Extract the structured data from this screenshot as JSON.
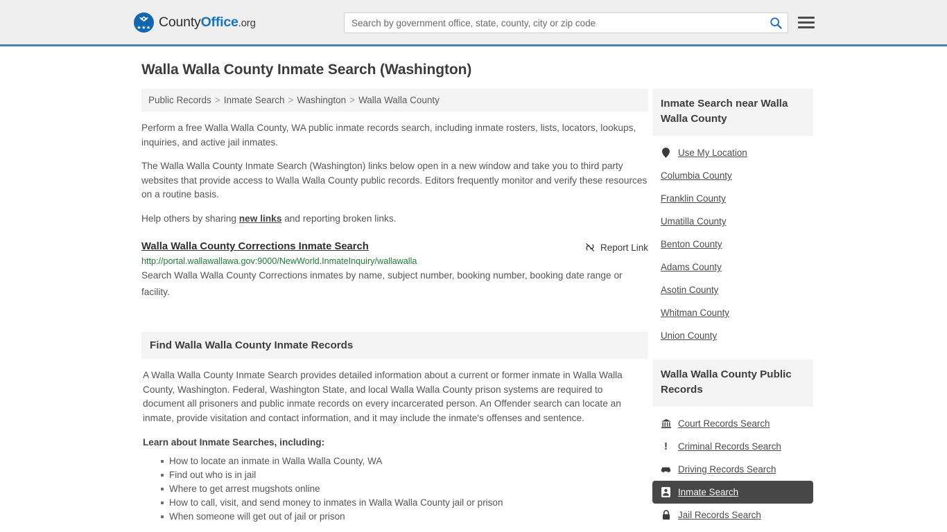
{
  "header": {
    "logo": {
      "part1": "County",
      "part2": "Office",
      "part3": ".org",
      "icon": "eagle-seal-logo"
    },
    "search": {
      "placeholder": "Search by government office, state, county, city or zip code",
      "value": "",
      "search_icon": "search-icon",
      "accent_color": "#1a6bb5"
    },
    "menu_icon": "hamburger-menu-icon",
    "border_color": "#4a7fad"
  },
  "main": {
    "title": "Walla Walla County Inmate Search (Washington)",
    "breadcrumb": [
      "Public Records",
      "Inmate Search",
      "Washington",
      "Walla Walla County"
    ],
    "breadcrumb_separator": ">",
    "paragraphs": [
      "Perform a free Walla Walla County, WA public inmate records search, including inmate rosters, lists, locators, lookups, inquiries, and active jail inmates.",
      "The Walla Walla County Inmate Search (Washington) links below open in a new window and take you to third party websites that provide access to Walla Walla County public records. Editors frequently monitor and verify these resources on a routine basis."
    ],
    "share_prefix": "Help others by sharing ",
    "share_link": "new links",
    "share_suffix": " and reporting broken links.",
    "resource": {
      "title": "Walla Walla County Corrections Inmate Search",
      "report_label": "Report Link",
      "report_icon": "broken-link-icon",
      "url": "http://portal.wallawallawa.gov:9000/NewWorld.InmateInquiry/wallawalla",
      "url_color": "#207b36",
      "description": "Search Walla Walla County Corrections inmates by name, subject number, booking number, booking date range or facility."
    },
    "section": {
      "heading": "Find Walla Walla County Inmate Records",
      "body": "A Walla Walla County Inmate Search provides detailed information about a current or former inmate in Walla Walla County, Washington. Federal, Washington State, and local Walla Walla County prison systems are required to document all prisoners and public inmate records on every incarcerated person. An Offender search can locate an inmate, provide visitation and contact information, and it may include the inmate's offenses and sentence.",
      "lead_in": "Learn about Inmate Searches, including:",
      "bullets": [
        "How to locate an inmate in Walla Walla County, WA",
        "Find out who is in jail",
        "Where to get arrest mugshots online",
        "How to call, visit, and send money to inmates in Walla Walla County jail or prison",
        "When someone will get out of jail or prison"
      ]
    }
  },
  "sidebar": {
    "nearby": {
      "heading": "Inmate Search near Walla Walla County",
      "items": [
        {
          "label": "Use My Location",
          "icon": "map-pin-icon"
        },
        {
          "label": "Columbia County",
          "icon": ""
        },
        {
          "label": "Franklin County",
          "icon": ""
        },
        {
          "label": "Umatilla County",
          "icon": ""
        },
        {
          "label": "Benton County",
          "icon": ""
        },
        {
          "label": "Adams County",
          "icon": ""
        },
        {
          "label": "Asotin County",
          "icon": ""
        },
        {
          "label": "Whitman County",
          "icon": ""
        },
        {
          "label": "Union County",
          "icon": ""
        }
      ]
    },
    "records": {
      "heading": "Walla Walla County Public Records",
      "active_label": "Inmate Search",
      "active_bg": "#474747",
      "items": [
        {
          "label": "Court Records Search",
          "icon": "courthouse-icon",
          "active": false
        },
        {
          "label": "Criminal Records Search",
          "icon": "exclamation-icon",
          "active": false
        },
        {
          "label": "Driving Records Search",
          "icon": "car-icon",
          "active": false
        },
        {
          "label": "Inmate Search",
          "icon": "id-badge-icon",
          "active": true
        },
        {
          "label": "Jail Records Search",
          "icon": "lock-icon",
          "active": false
        }
      ]
    }
  }
}
